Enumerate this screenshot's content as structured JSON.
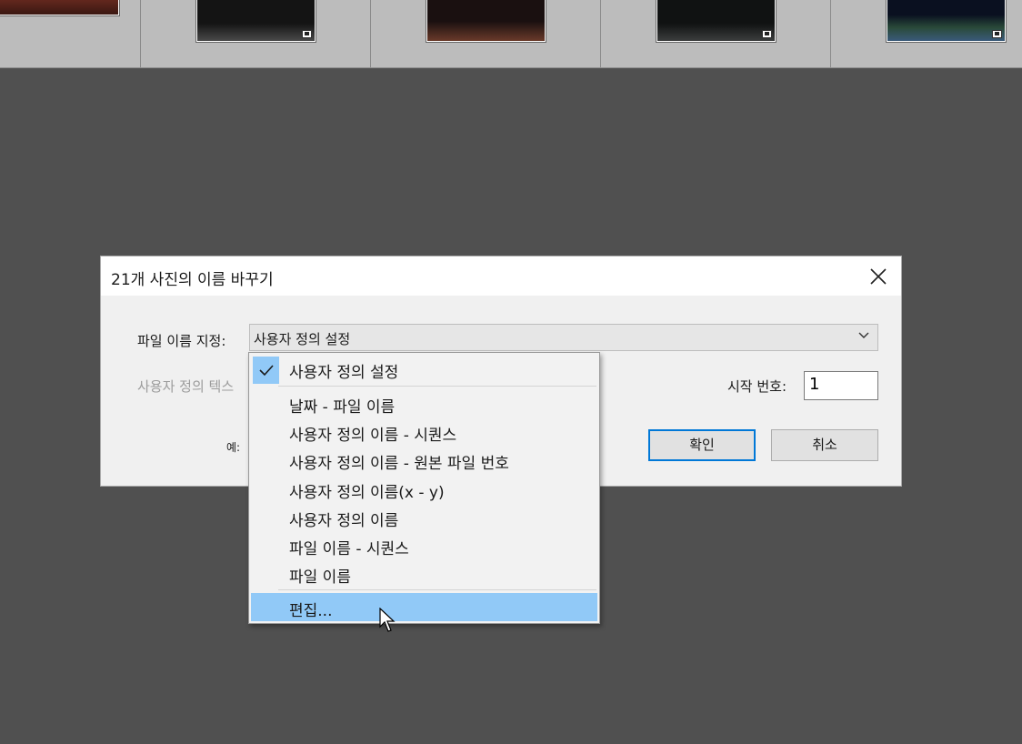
{
  "filmstrip": {
    "thumbnails": [
      {
        "name": "thumb-1",
        "colors": [
          "#6a2a20",
          "#3a1812"
        ]
      },
      {
        "name": "thumb-2",
        "colors": [
          "#141414",
          "#4a4a4a"
        ]
      },
      {
        "name": "thumb-3",
        "colors": [
          "#1a1010",
          "#6a3a2a"
        ]
      },
      {
        "name": "thumb-4",
        "colors": [
          "#101212",
          "#3c3e3e"
        ]
      },
      {
        "name": "thumb-5",
        "colors": [
          "#0a1020",
          "#3a5a7a"
        ]
      }
    ]
  },
  "dialog": {
    "title": "21개 사진의 이름 바꾸기",
    "close_icon": "close-icon",
    "filename_label": "파일 이름 지정:",
    "filename_selected": "사용자 정의 설정",
    "custom_text_label": "사용자 정의 텍스",
    "example_label": "예:",
    "start_number_label": "시작 번호:",
    "start_number_value": "1",
    "ok_label": "확인",
    "cancel_label": "취소"
  },
  "dropdown": {
    "checked_item": "사용자 정의 설정",
    "items": [
      "날짜 - 파일 이름",
      "사용자 정의 이름 - 시퀀스",
      "사용자 정의 이름 - 원본 파일 번호",
      "사용자 정의 이름(x - y)",
      "사용자 정의 이름",
      "파일 이름 - 시퀀스",
      "파일 이름"
    ],
    "edit_item": "편집..."
  },
  "colors": {
    "highlight": "#91c9f7",
    "primary_border": "#0078d7",
    "background": "#505050"
  }
}
